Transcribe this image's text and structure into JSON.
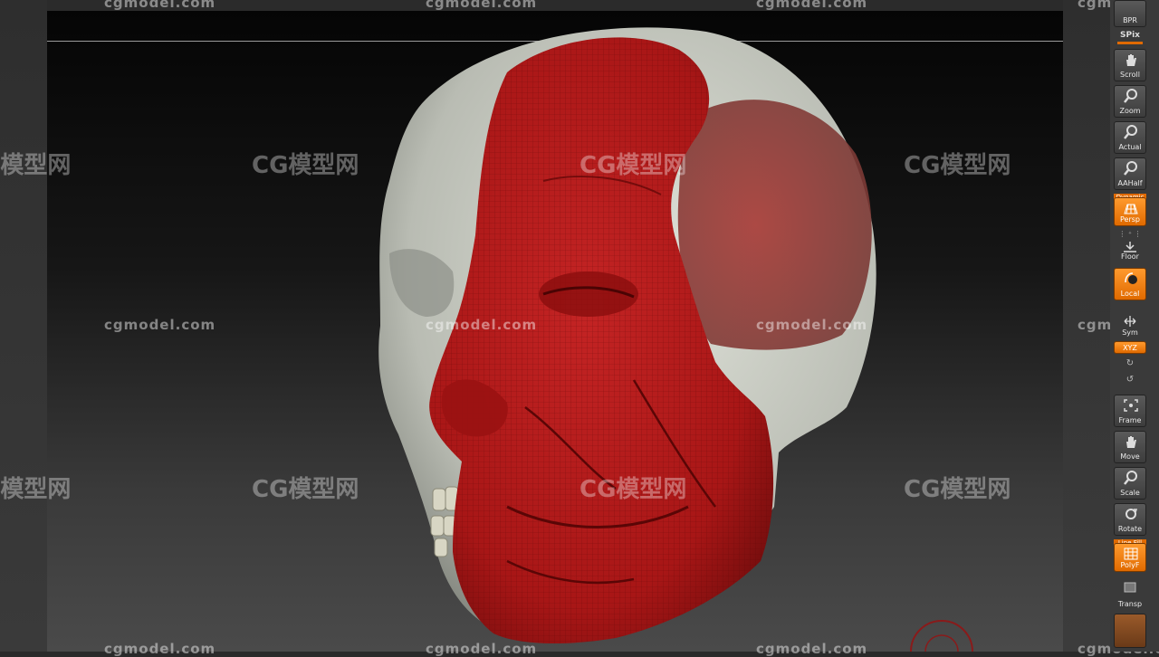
{
  "shelf": {
    "bpr": "BPR",
    "spix": "SPix",
    "tools": [
      {
        "label": "Scroll",
        "active": false
      },
      {
        "label": "Zoom",
        "active": false
      },
      {
        "label": "Actual",
        "active": false
      },
      {
        "label": "AAHalf",
        "active": false
      },
      {
        "label": "Persp",
        "active": true,
        "tag": "Dynamic"
      },
      {
        "label": "Floor",
        "active": false
      },
      {
        "label": "Local",
        "active": true
      },
      {
        "label": "Sym",
        "active": false
      },
      {
        "label": "XYZ",
        "active": true
      },
      {
        "label": "Frame",
        "active": false
      },
      {
        "label": "Move",
        "active": false
      },
      {
        "label": "Scale",
        "active": false
      },
      {
        "label": "Rotate",
        "active": false
      },
      {
        "label": "PolyF",
        "active": true,
        "tag": "Line Fill"
      },
      {
        "label": "Transp",
        "active": false
      }
    ]
  },
  "watermark": {
    "url": "cgmodel.com",
    "logo": "CG模型网"
  },
  "colors": {
    "muscle": "#b01818",
    "bone": "#c8cbc2",
    "accent": "#e06a00"
  }
}
